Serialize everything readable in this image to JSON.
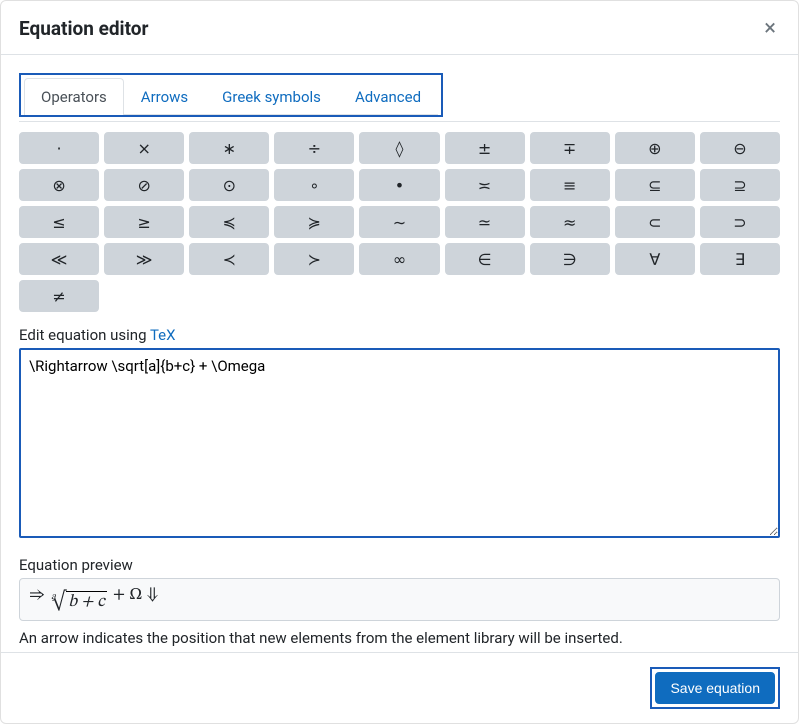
{
  "header": {
    "title": "Equation editor",
    "close_glyph": "×"
  },
  "tabs": [
    {
      "label": "Operators",
      "active": true
    },
    {
      "label": "Arrows",
      "active": false
    },
    {
      "label": "Greek symbols",
      "active": false
    },
    {
      "label": "Advanced",
      "active": false
    }
  ],
  "operators": [
    "·",
    "×",
    "∗",
    "÷",
    "◊",
    "±",
    "∓",
    "⊕",
    "⊖",
    "⊗",
    "⊘",
    "⊙",
    "∘",
    "•",
    "≍",
    "≡",
    "⊆",
    "⊇",
    "≤",
    "≥",
    "≼",
    "≽",
    "∼",
    "≃",
    "≈",
    "⊂",
    "⊃",
    "≪",
    "≫",
    "≺",
    "≻",
    "∞",
    "∈",
    "∋",
    "∀",
    "∃",
    "≠"
  ],
  "edit": {
    "label_prefix": "Edit equation using ",
    "tex_link": "TeX",
    "value": "\\Rightarrow \\sqrt[a]{b+c} + \\Omega"
  },
  "preview": {
    "label": "Equation preview",
    "leading_arrow": "⇒",
    "root_index": "a",
    "root_body": "b + c",
    "plus": "+",
    "omega": "Ω",
    "insert_marker": "⇓"
  },
  "help_text": "An arrow indicates the position that new elements from the element library will be inserted.",
  "footer": {
    "save_label": "Save equation"
  }
}
